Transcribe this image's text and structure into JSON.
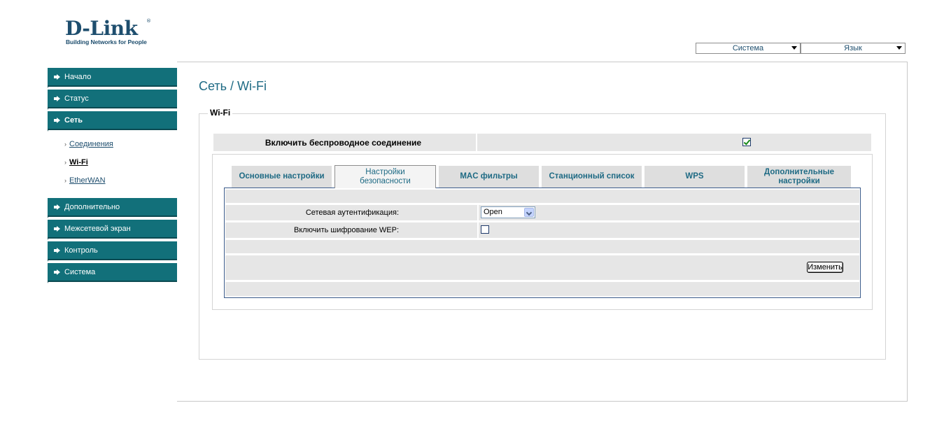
{
  "logo": {
    "brand": "D-Link",
    "registered": "®",
    "tagline": "Building Networks for People"
  },
  "top_selects": {
    "system": "Система",
    "language": "Язык"
  },
  "sidebar": {
    "items": [
      {
        "label": "Начало"
      },
      {
        "label": "Статус"
      },
      {
        "label": "Сеть"
      },
      {
        "label": "Дополнительно"
      },
      {
        "label": "Межсетевой экран"
      },
      {
        "label": "Контроль"
      },
      {
        "label": "Система"
      }
    ],
    "sub_items": [
      {
        "label": "Соединения"
      },
      {
        "label": "Wi-Fi"
      },
      {
        "label": "EtherWAN"
      }
    ]
  },
  "main": {
    "title": "Сеть / Wi-Fi",
    "legend": "Wi-Fi",
    "enable_wireless_label": "Включить беспроводное соединение",
    "enable_wireless_checked": true,
    "tabs": [
      {
        "label": "Основные настройки"
      },
      {
        "label": "Настройки безопасности"
      },
      {
        "label": "MAC фильтры"
      },
      {
        "label": "Станционный список"
      },
      {
        "label": "WPS"
      },
      {
        "label": "Дополнительные настройки"
      }
    ],
    "active_tab": 1,
    "form": {
      "auth_label": "Сетевая аутентификация:",
      "auth_value": "Open",
      "wep_label": "Включить шифрование WEP:",
      "wep_checked": false,
      "apply_label": "Изменить"
    }
  },
  "colors": {
    "sidebar_bg": "#12707a",
    "title": "#1e6a84",
    "row_bg": "#e6e6e6",
    "check": "#1a8a1a"
  }
}
